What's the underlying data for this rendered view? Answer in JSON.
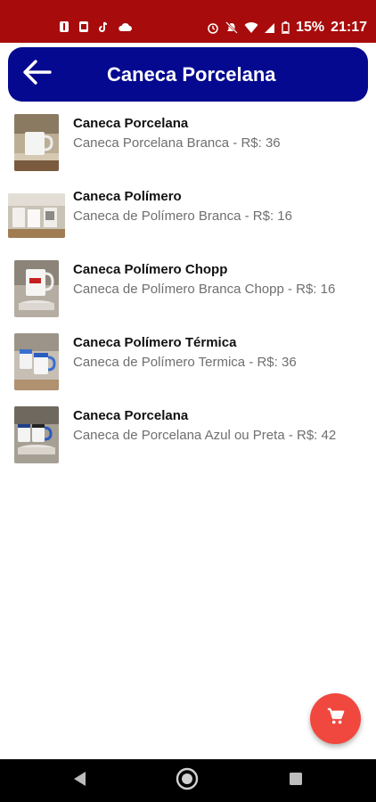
{
  "status_bar": {
    "battery": "15%",
    "time": "21:17",
    "left_icons": [
      "notification-icon",
      "notification-icon",
      "tiktok-icon",
      "cloud-icon"
    ],
    "right_icons": [
      "alarm-icon",
      "mute-icon",
      "wifi-icon",
      "signal-icon",
      "battery-icon"
    ]
  },
  "app_bar": {
    "title": "Caneca Porcelana",
    "back_icon": "arrow-back-icon",
    "color": "#05098f"
  },
  "products": [
    {
      "title": "Caneca Porcelana",
      "subtitle": "Caneca Porcelana Branca - R$: 36"
    },
    {
      "title": "Caneca Polímero",
      "subtitle": "Caneca de Polímero Branca - R$: 16"
    },
    {
      "title": "Caneca Polímero Chopp",
      "subtitle": "Caneca de Polímero Branca Chopp - R$: 16"
    },
    {
      "title": "Caneca Polímero Térmica",
      "subtitle": "Caneca de Polímero Termica - R$: 36"
    },
    {
      "title": "Caneca Porcelana",
      "subtitle": "Caneca de Porcelana Azul ou Preta - R$: 42"
    }
  ],
  "fab": {
    "icon": "cart-icon",
    "color": "#f0483e"
  },
  "nav_bar": {
    "icons": [
      "nav-back-icon",
      "nav-home-icon",
      "nav-recents-icon"
    ]
  },
  "colors": {
    "status_bar": "#a80b0b"
  }
}
